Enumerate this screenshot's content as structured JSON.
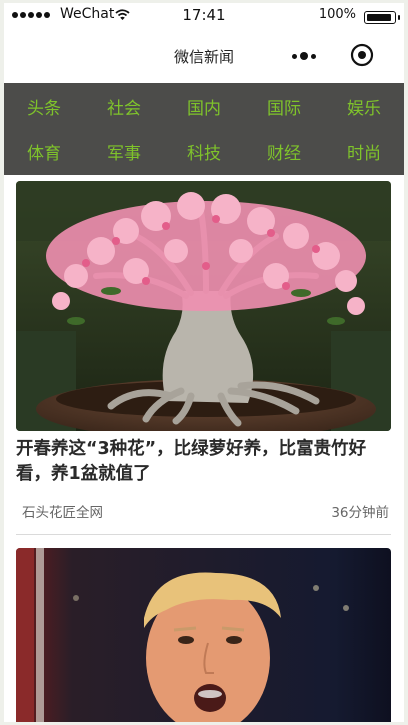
{
  "status_bar": {
    "carrier": "WeChat",
    "time": "17:41",
    "battery_percent": "100%",
    "battery_level": 1.0
  },
  "nav": {
    "title": "微信新闻"
  },
  "categories": [
    "头条",
    "社会",
    "国内",
    "国际",
    "娱乐",
    "体育",
    "军事",
    "科技",
    "财经",
    "时尚"
  ],
  "articles": [
    {
      "title": "开春养这“3种花”，比绿萝好养，比富贵竹好看，养1盆就值了",
      "source": "石头花匠全网",
      "time": "36分钟前"
    }
  ],
  "colors": {
    "category_bar": "#4c4c4a",
    "category_text": "#7fc32b"
  }
}
